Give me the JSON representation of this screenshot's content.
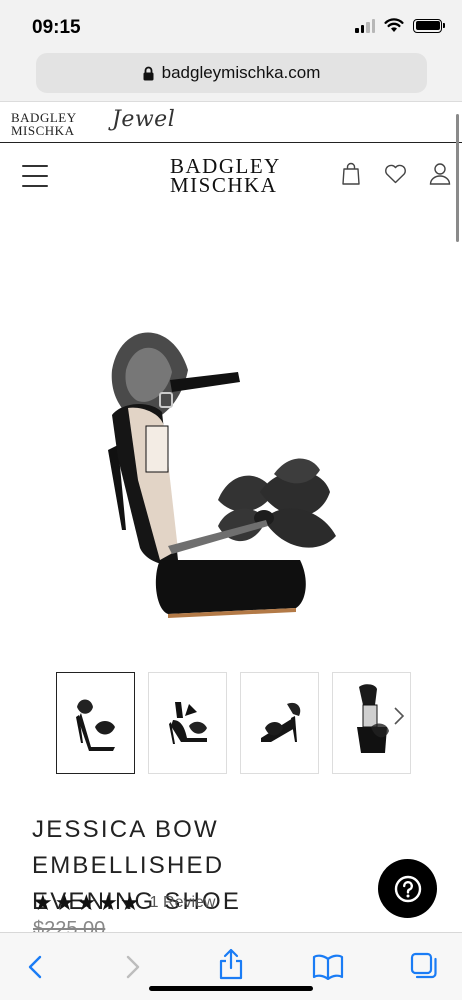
{
  "status_bar": {
    "time": "09:15"
  },
  "browser": {
    "url": "badgleymischka.com"
  },
  "brand_strip": {
    "logo_line1": "BADGLEY",
    "logo_line2": "MISCHKA",
    "sub_brand": "Jewel"
  },
  "header": {
    "logo_line1": "BADGLEY",
    "logo_line2": "MISCHKA"
  },
  "product": {
    "title_line1": "JESSICA BOW EMBELLISHED",
    "title_line2": "EVENING SHOE",
    "rating": 5,
    "stars": [
      "★",
      "★",
      "★",
      "★",
      "★"
    ],
    "review_count": "1 Review",
    "price": "$225.00"
  },
  "icons": {
    "lock": "lock-icon",
    "menu": "hamburger-menu-icon",
    "bag": "shopping-bag-icon",
    "wishlist": "heart-icon",
    "account": "user-icon",
    "help": "question-mark-icon",
    "back": "chevron-left-icon",
    "forward": "chevron-right-icon",
    "share": "share-icon",
    "bookmarks": "book-icon",
    "tabs": "tabs-icon"
  },
  "colors": {
    "accent_ios": "#1a7cf5",
    "text": "#111111",
    "price": "#888888"
  }
}
